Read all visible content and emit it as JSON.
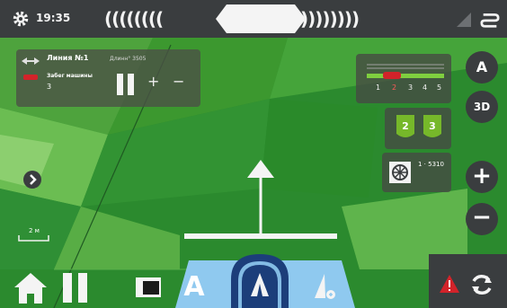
{
  "status_bar": {
    "time": "19:35",
    "left_chevrons": "((((((((",
    "right_chevrons": "))))))))"
  },
  "guidance_line": {
    "name": "Линия №1",
    "distance": "Длинн° 3505",
    "swath_label": "Забег машины",
    "swath_value": "3",
    "plus": "+",
    "minus": "−"
  },
  "sections": {
    "numbers": [
      "1",
      "2",
      "3",
      "4",
      "5"
    ],
    "active_section": "2"
  },
  "gears": [
    "2",
    "3"
  ],
  "engine": {
    "rpm": "1 · 5310"
  },
  "map_controls": {
    "auto_label": "A",
    "view_label": "3D",
    "zoom_in": "+",
    "zoom_out": "−"
  },
  "scale": {
    "label": "2 м"
  },
  "bottom": {
    "mode_a": "A"
  },
  "icons": [
    "gear-icon",
    "signal-icon",
    "switch-icon",
    "pause-icon",
    "home-icon",
    "warning-icon",
    "refresh-icon",
    "tractor-icon",
    "rpm-icon"
  ],
  "colors": {
    "field_green": "#2c8a30",
    "bar_dark": "#3a3d3f",
    "ab_blue": "#8fc9ef",
    "ab_dark": "#1c3e7a",
    "warning_red": "#d2232a",
    "gear_green": "#76b82a"
  }
}
